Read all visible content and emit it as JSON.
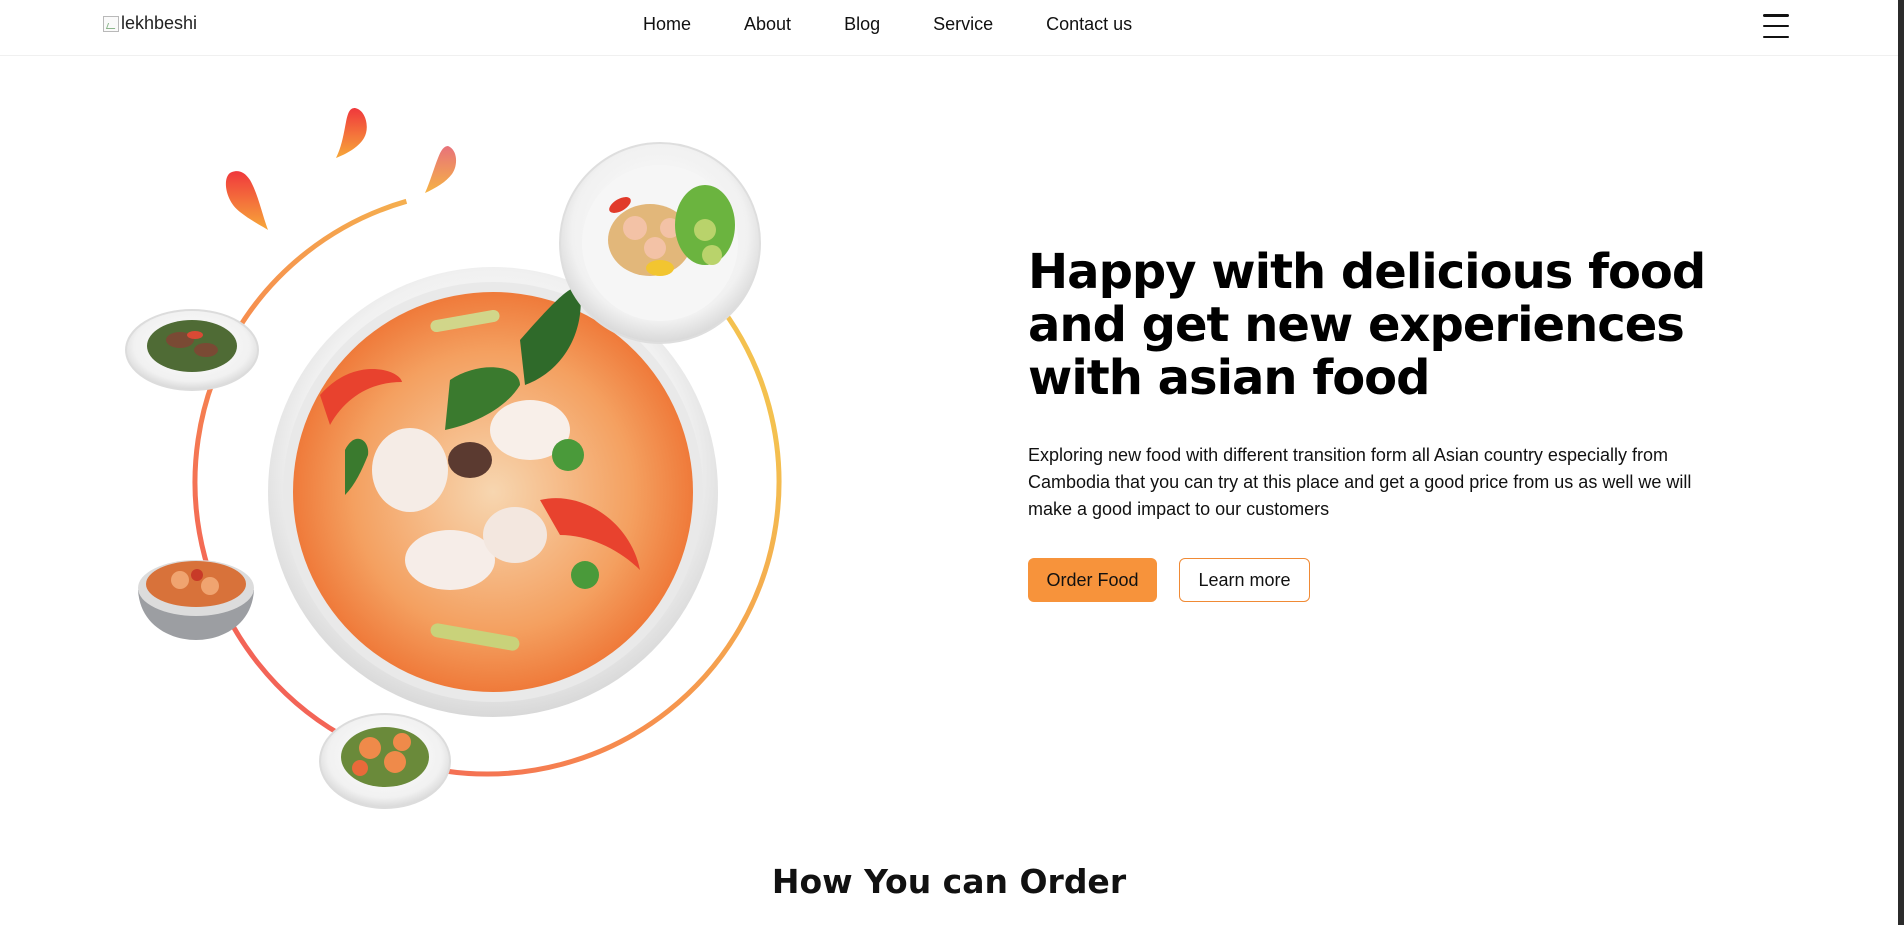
{
  "nav": {
    "logo_alt": "lekhbeshi",
    "links": [
      "Home",
      "About",
      "Blog",
      "Service",
      "Contact us"
    ]
  },
  "hero": {
    "title": "Happy with delicious food and get new experiences with asian food",
    "description": "Exploring new food with different transition form all Asian country especially from Cambodia that you can try at this place and get a good price from us as well we will make a good impact to our customers",
    "order_button": "Order Food",
    "learn_button": "Learn more"
  },
  "sections": {
    "how_to_order": "How You can Order"
  },
  "colors": {
    "accent": "#f7933b",
    "ring_red": "#f2565a",
    "ring_yellow": "#f4c14f"
  }
}
